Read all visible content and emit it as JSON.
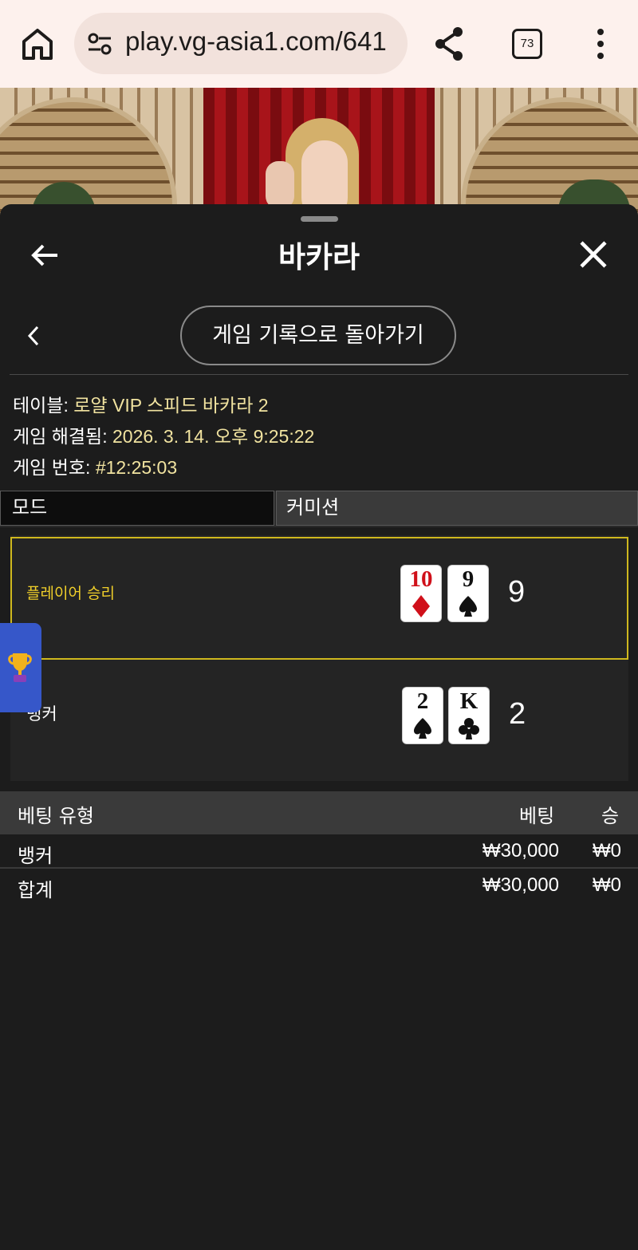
{
  "browser": {
    "url": "play.vg-asia1.com/641",
    "tab_count": "73"
  },
  "sheet": {
    "title": "바카라",
    "history_button": "게임 기록으로 돌아가기"
  },
  "info": {
    "table_label": "테이블:",
    "table_value": "로얄 VIP 스피드 바카라 2",
    "resolved_label": "게임 해결됨:",
    "resolved_value": "2026. 3. 14. 오후 9:25:22",
    "number_label": "게임 번호:",
    "number_value": "#12:25:03"
  },
  "tabs": {
    "mode": "모드",
    "commission": "커미션"
  },
  "results": {
    "player": {
      "label": "플레이어 승리",
      "cards": [
        {
          "rank": "10",
          "suit": "diamond"
        },
        {
          "rank": "9",
          "suit": "spade"
        }
      ],
      "score": "9"
    },
    "banker": {
      "label": "뱅커",
      "cards": [
        {
          "rank": "2",
          "suit": "spade"
        },
        {
          "rank": "K",
          "suit": "club"
        }
      ],
      "score": "2"
    }
  },
  "bets": {
    "headers": {
      "type": "베팅 유형",
      "bet": "베팅",
      "win": "승"
    },
    "rows": [
      {
        "type": "뱅커",
        "bet": "₩30,000",
        "win": "₩0"
      },
      {
        "type": "합계",
        "bet": "₩30,000",
        "win": "₩0"
      }
    ]
  },
  "icons": {
    "home": "home-icon",
    "site_info": "tune-icon",
    "share": "share-icon",
    "menu": "more-vert-icon",
    "back": "arrow-left-icon",
    "close": "close-icon",
    "chevron": "chevron-left-icon",
    "trophy": "trophy-icon"
  },
  "colors": {
    "winner_border": "#cfb81e",
    "winner_text": "#f0cf2a",
    "info_value": "#f1e3a0",
    "widget": "#3657c9"
  }
}
